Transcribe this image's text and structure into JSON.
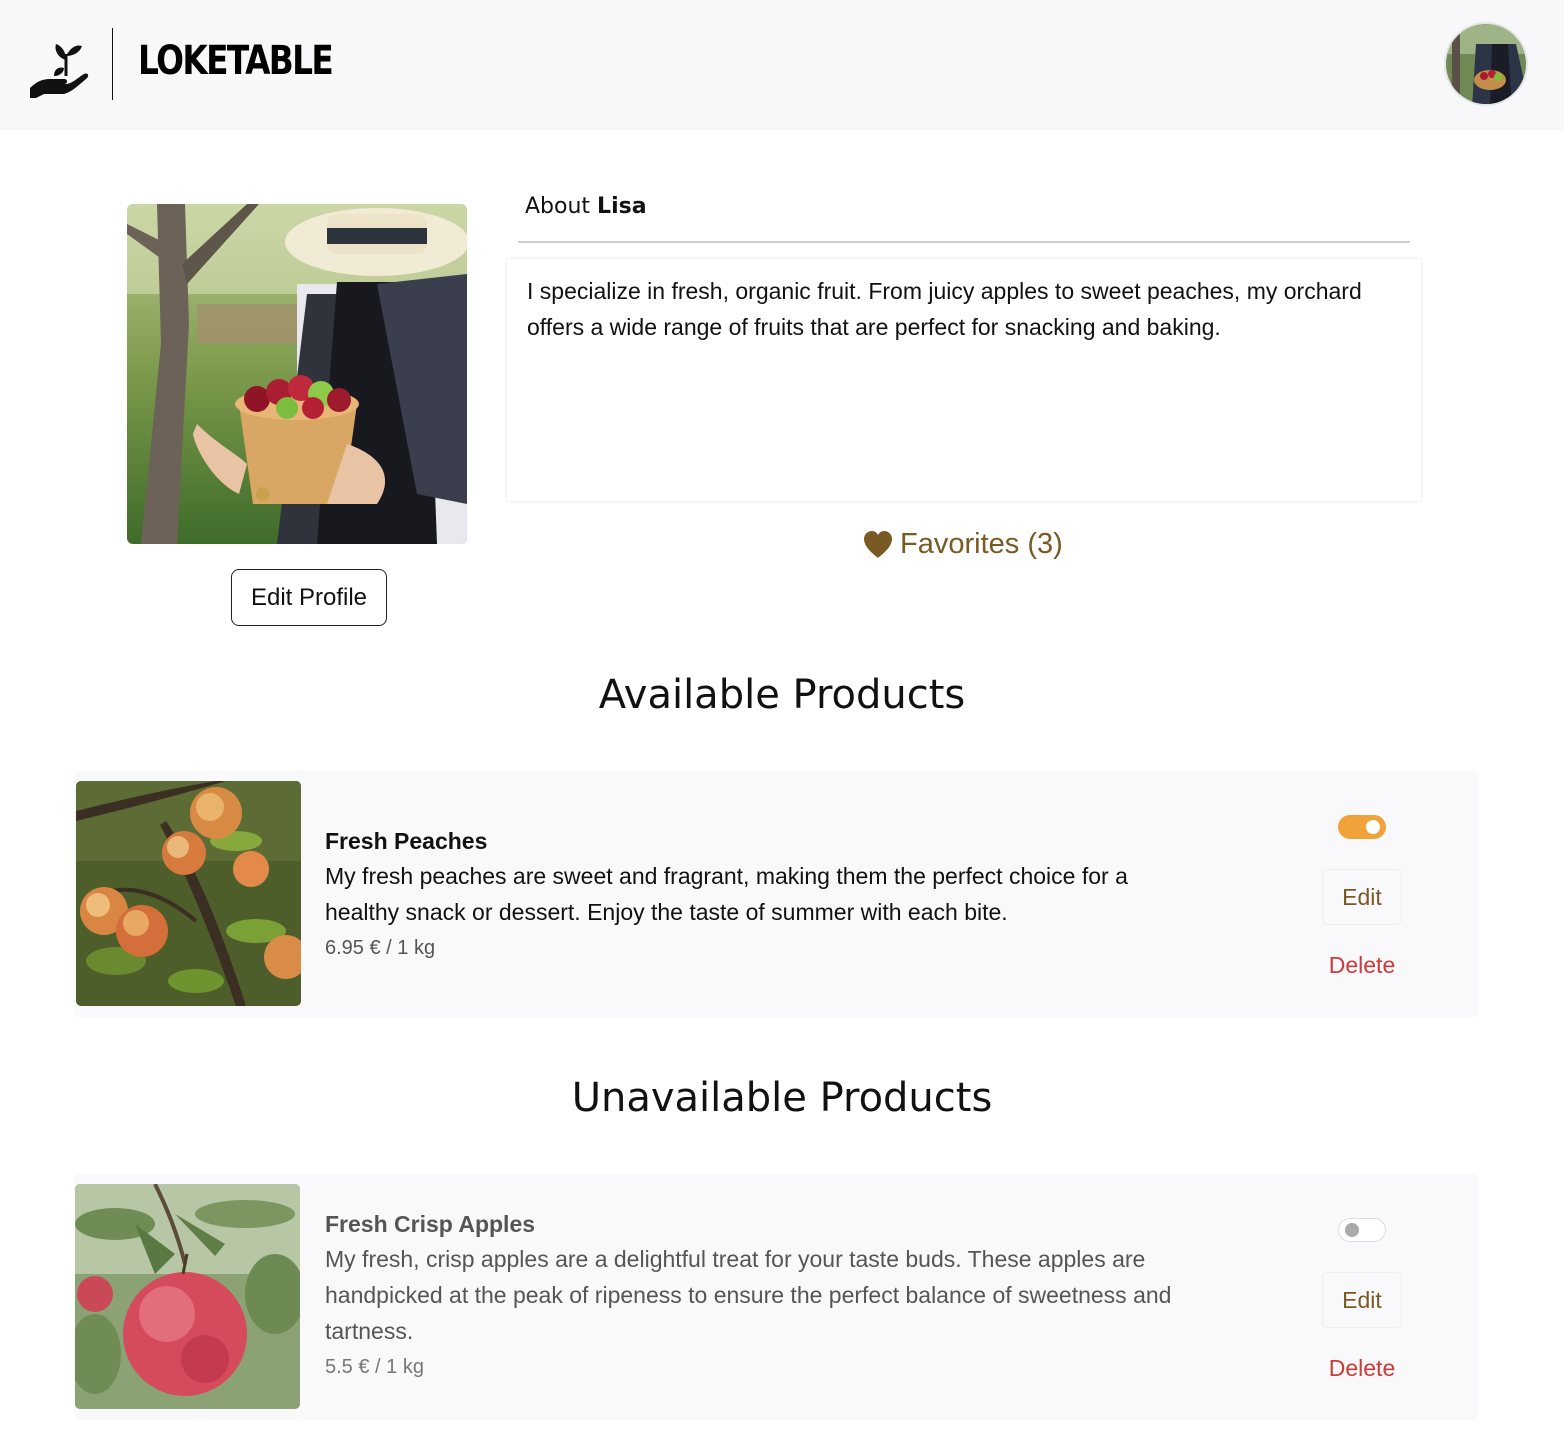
{
  "header": {
    "logo_text": "LOKETABLE",
    "logo_icon": "hand-sprout-icon",
    "avatar_alt": "user-avatar"
  },
  "profile": {
    "edit_button": "Edit Profile",
    "about_prefix": "About",
    "about_name": "Lisa",
    "bio": "I specialize in fresh, organic fruit. From juicy apples to sweet peaches, my orchard offers a wide range of fruits that are perfect for snacking and baking.",
    "favorites_label": "Favorites (3)"
  },
  "sections": {
    "available_title": "Available Products",
    "unavailable_title": "Unavailable Products"
  },
  "products": {
    "available": [
      {
        "title": "Fresh Peaches",
        "description": "My fresh peaches are sweet and fragrant, making them the perfect choice for a healthy snack or dessert. Enjoy the taste of summer with each bite.",
        "price": "6.95 € / 1 kg",
        "available": true,
        "edit_label": "Edit",
        "delete_label": "Delete"
      }
    ],
    "unavailable": [
      {
        "title": "Fresh Crisp Apples",
        "description": "My fresh, crisp apples are a delightful treat for your taste buds. These apples are handpicked at the peak of ripeness to ensure the perfect balance of sweetness and tartness.",
        "price": "5.5 € / 1 kg",
        "available": false,
        "edit_label": "Edit",
        "delete_label": "Delete"
      }
    ]
  },
  "colors": {
    "accent_brown": "#7a5a24",
    "toggle_on": "#f0a33a",
    "delete_red": "#cc3b3b",
    "header_bg": "#f8f8fa"
  }
}
